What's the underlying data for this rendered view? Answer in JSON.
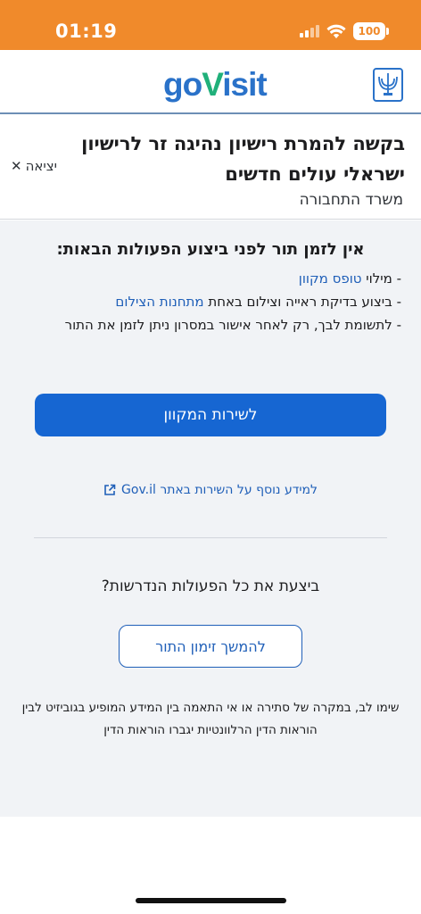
{
  "status_bar": {
    "time": "01:19",
    "battery": "100",
    "icons": [
      "signal-icon",
      "wifi-icon",
      "battery-icon"
    ]
  },
  "header": {
    "brand_prefix": "go",
    "brand_v": "V",
    "brand_suffix": "isit",
    "emblem_icon": "state-emblem-icon"
  },
  "request": {
    "title": "בקשה להמרת רישיון נהיגה זר לרישיון ישראלי עולים חדשים",
    "ministry": "משרד התחבורה",
    "exit_label": "יציאה"
  },
  "notice": {
    "heading": "אין לזמן תור לפני ביצוע הפעולות הבאות:",
    "step1_prefix": "- מילוי ",
    "step1_link": "טופס מקוון",
    "step2_prefix": "- ביצוע בדיקת ראייה וצילום באחת ",
    "step2_link": "מתחנות הצילום",
    "step3": "- לתשומת לבך, רק לאחר אישור במסרון ניתן לזמן את התור"
  },
  "actions": {
    "online_service_label": "לשירות המקוון",
    "gov_link_label": "למידע נוסף על השירות באתר Gov.il",
    "question": "ביצעת את כל הפעולות הנדרשות?",
    "continue_label": "להמשך זימון התור"
  },
  "disclaimer": "שימו לב, במקרה של סתירה או אי התאמה בין המידע המופיע בגוביזיט לבין הוראות הדין הרלוונטיות יגברו הוראות הדין",
  "colors": {
    "status_bar": "#f08a2b",
    "brand_blue": "#2a72c9",
    "brand_green": "#20b07a",
    "primary_button": "#1666d2",
    "link": "#1f5fb8",
    "content_bg": "#f1f3f6"
  }
}
